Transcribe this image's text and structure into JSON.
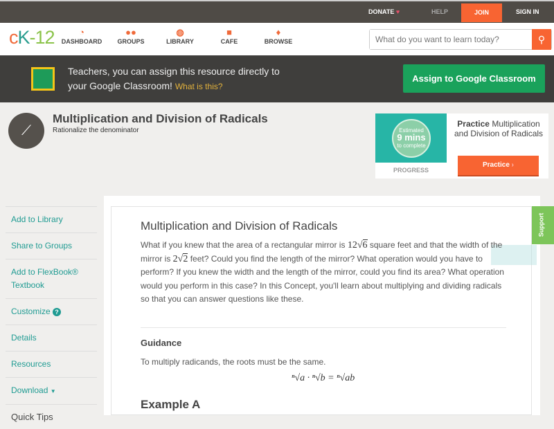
{
  "topbar": {
    "donate": "DONATE",
    "help": "HELP",
    "join": "JOIN",
    "signin": "SIGN IN"
  },
  "nav": {
    "logo": "cK-12",
    "items": [
      {
        "label": "DASHBOARD",
        "icon": "dashboard-icon"
      },
      {
        "label": "GROUPS",
        "icon": "groups-icon"
      },
      {
        "label": "LIBRARY",
        "icon": "library-icon"
      },
      {
        "label": "CAFE",
        "icon": "cafe-icon"
      },
      {
        "label": "BROWSE",
        "icon": "browse-icon"
      }
    ],
    "search_placeholder": "What do you want to learn today?"
  },
  "banner": {
    "text": "Teachers, you can assign this resource directly to your Google Classroom!",
    "link": "What is this?",
    "button": "Assign to Google Classroom"
  },
  "header": {
    "title": "Multiplication and Division of Radicals",
    "subtitle": "Rationalize the denominator"
  },
  "practice": {
    "estimated": "Estimated",
    "mins": "9 mins",
    "to_complete": "to complete",
    "progress": "PROGRESS",
    "title_bold": "Practice",
    "title_rest": "Multiplication and Division of Radicals",
    "button": "Practice"
  },
  "sidebar": {
    "items": [
      "Add to Library",
      "Share to Groups",
      "Add to FlexBook® Textbook",
      "Customize",
      "Details",
      "Resources",
      "Download"
    ],
    "quick_tips": "Quick Tips"
  },
  "content": {
    "title": "Multiplication and Division of Radicals",
    "p1a": "What if you knew that the area of a rectangular mirror is ",
    "area_coef": "12",
    "area_rad": "6",
    "p1b": " square feet and that the width of the mirror is ",
    "width_coef": "2",
    "width_rad": "2",
    "p1c": " feet? Could you find the length of the mirror? What operation would you have to perform? If you knew the width and the length of the mirror, could you find its area? What operation would you perform in this case? In this Concept, you'll learn about multiplying and dividing radicals so that you can answer questions like these.",
    "guidance": "Guidance",
    "guidance_text": "To multiply radicands, the roots must be the same.",
    "formula": "ⁿ√a · ⁿ√b = ⁿ√ab",
    "example": "Example A"
  },
  "support": "Support"
}
